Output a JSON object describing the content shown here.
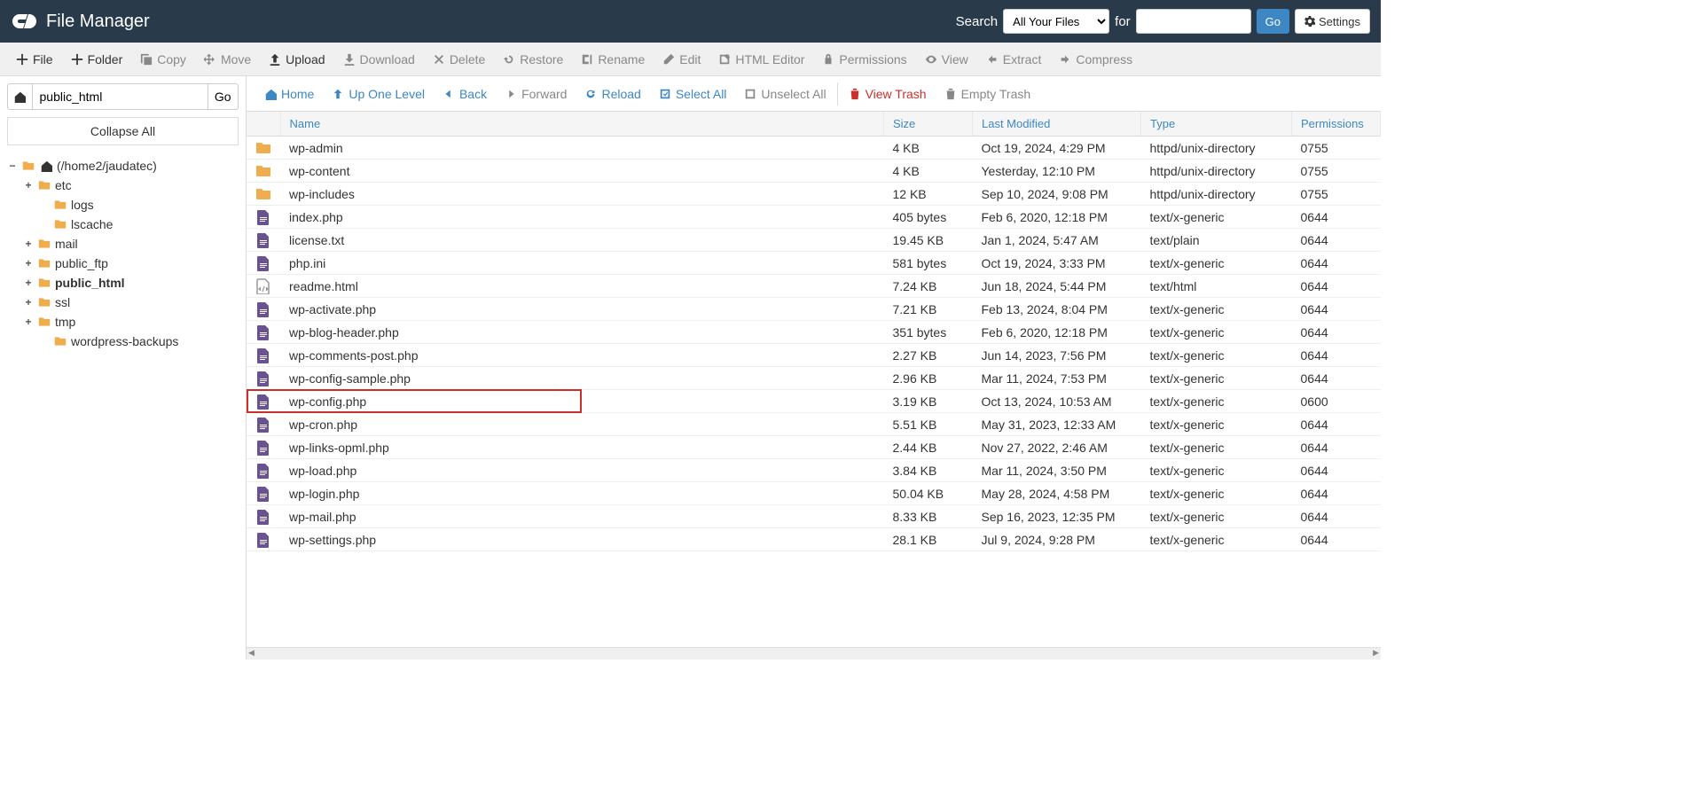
{
  "header": {
    "app_title": "File Manager",
    "search_label": "Search",
    "search_scope": "All Your Files",
    "for_label": "for",
    "go_label": "Go",
    "settings_label": "Settings"
  },
  "toolbar": [
    {
      "label": "File",
      "icon": "plus",
      "active": true
    },
    {
      "label": "Folder",
      "icon": "plus",
      "active": true
    },
    {
      "label": "Copy",
      "icon": "copy",
      "active": false
    },
    {
      "label": "Move",
      "icon": "move",
      "active": false
    },
    {
      "label": "Upload",
      "icon": "upload",
      "active": true
    },
    {
      "label": "Download",
      "icon": "download",
      "active": false
    },
    {
      "label": "Delete",
      "icon": "delete",
      "active": false
    },
    {
      "label": "Restore",
      "icon": "restore",
      "active": false
    },
    {
      "label": "Rename",
      "icon": "rename",
      "active": false
    },
    {
      "label": "Edit",
      "icon": "edit",
      "active": false
    },
    {
      "label": "HTML Editor",
      "icon": "html-editor",
      "active": false
    },
    {
      "label": "Permissions",
      "icon": "permissions",
      "active": false
    },
    {
      "label": "View",
      "icon": "view",
      "active": false
    },
    {
      "label": "Extract",
      "icon": "extract",
      "active": false
    },
    {
      "label": "Compress",
      "icon": "compress",
      "active": false
    }
  ],
  "location": {
    "path_value": "public_html",
    "go_label": "Go",
    "collapse_label": "Collapse All"
  },
  "tree": {
    "root_label": "(/home2/jaudatec)",
    "items": [
      {
        "label": "etc",
        "toggle": "+",
        "depth": 1
      },
      {
        "label": "logs",
        "toggle": "",
        "depth": 2
      },
      {
        "label": "lscache",
        "toggle": "",
        "depth": 2
      },
      {
        "label": "mail",
        "toggle": "+",
        "depth": 1
      },
      {
        "label": "public_ftp",
        "toggle": "+",
        "depth": 1
      },
      {
        "label": "public_html",
        "toggle": "+",
        "depth": 1,
        "bold": true
      },
      {
        "label": "ssl",
        "toggle": "+",
        "depth": 1
      },
      {
        "label": "tmp",
        "toggle": "+",
        "depth": 1
      },
      {
        "label": "wordpress-backups",
        "toggle": "",
        "depth": 2
      }
    ]
  },
  "navbar": [
    {
      "label": "Home",
      "icon": "home",
      "style": "link"
    },
    {
      "label": "Up One Level",
      "icon": "up",
      "style": "link"
    },
    {
      "label": "Back",
      "icon": "back",
      "style": "link"
    },
    {
      "label": "Forward",
      "icon": "forward",
      "style": "disabled"
    },
    {
      "label": "Reload",
      "icon": "reload",
      "style": "link"
    },
    {
      "label": "Select All",
      "icon": "select-all",
      "style": "link"
    },
    {
      "label": "Unselect All",
      "icon": "unselect-all",
      "style": "disabled"
    },
    {
      "label": "View Trash",
      "icon": "trash",
      "style": "danger",
      "sep_before": true
    },
    {
      "label": "Empty Trash",
      "icon": "trash",
      "style": "disabled"
    }
  ],
  "columns": {
    "name": "Name",
    "size": "Size",
    "modified": "Last Modified",
    "type": "Type",
    "permissions": "Permissions"
  },
  "files": [
    {
      "icon": "folder",
      "name": "wp-admin",
      "size": "4 KB",
      "modified": "Oct 19, 2024, 4:29 PM",
      "type": "httpd/unix-directory",
      "perm": "0755"
    },
    {
      "icon": "folder",
      "name": "wp-content",
      "size": "4 KB",
      "modified": "Yesterday, 12:10 PM",
      "type": "httpd/unix-directory",
      "perm": "0755"
    },
    {
      "icon": "folder",
      "name": "wp-includes",
      "size": "12 KB",
      "modified": "Sep 10, 2024, 9:08 PM",
      "type": "httpd/unix-directory",
      "perm": "0755"
    },
    {
      "icon": "file",
      "name": "index.php",
      "size": "405 bytes",
      "modified": "Feb 6, 2020, 12:18 PM",
      "type": "text/x-generic",
      "perm": "0644"
    },
    {
      "icon": "file",
      "name": "license.txt",
      "size": "19.45 KB",
      "modified": "Jan 1, 2024, 5:47 AM",
      "type": "text/plain",
      "perm": "0644"
    },
    {
      "icon": "file",
      "name": "php.ini",
      "size": "581 bytes",
      "modified": "Oct 19, 2024, 3:33 PM",
      "type": "text/x-generic",
      "perm": "0644"
    },
    {
      "icon": "html",
      "name": "readme.html",
      "size": "7.24 KB",
      "modified": "Jun 18, 2024, 5:44 PM",
      "type": "text/html",
      "perm": "0644"
    },
    {
      "icon": "file",
      "name": "wp-activate.php",
      "size": "7.21 KB",
      "modified": "Feb 13, 2024, 8:04 PM",
      "type": "text/x-generic",
      "perm": "0644"
    },
    {
      "icon": "file",
      "name": "wp-blog-header.php",
      "size": "351 bytes",
      "modified": "Feb 6, 2020, 12:18 PM",
      "type": "text/x-generic",
      "perm": "0644"
    },
    {
      "icon": "file",
      "name": "wp-comments-post.php",
      "size": "2.27 KB",
      "modified": "Jun 14, 2023, 7:56 PM",
      "type": "text/x-generic",
      "perm": "0644"
    },
    {
      "icon": "file",
      "name": "wp-config-sample.php",
      "size": "2.96 KB",
      "modified": "Mar 11, 2024, 7:53 PM",
      "type": "text/x-generic",
      "perm": "0644"
    },
    {
      "icon": "file",
      "name": "wp-config.php",
      "size": "3.19 KB",
      "modified": "Oct 13, 2024, 10:53 AM",
      "type": "text/x-generic",
      "perm": "0600",
      "highlight": true
    },
    {
      "icon": "file",
      "name": "wp-cron.php",
      "size": "5.51 KB",
      "modified": "May 31, 2023, 12:33 AM",
      "type": "text/x-generic",
      "perm": "0644"
    },
    {
      "icon": "file",
      "name": "wp-links-opml.php",
      "size": "2.44 KB",
      "modified": "Nov 27, 2022, 2:46 AM",
      "type": "text/x-generic",
      "perm": "0644"
    },
    {
      "icon": "file",
      "name": "wp-load.php",
      "size": "3.84 KB",
      "modified": "Mar 11, 2024, 3:50 PM",
      "type": "text/x-generic",
      "perm": "0644"
    },
    {
      "icon": "file",
      "name": "wp-login.php",
      "size": "50.04 KB",
      "modified": "May 28, 2024, 4:58 PM",
      "type": "text/x-generic",
      "perm": "0644"
    },
    {
      "icon": "file",
      "name": "wp-mail.php",
      "size": "8.33 KB",
      "modified": "Sep 16, 2023, 12:35 PM",
      "type": "text/x-generic",
      "perm": "0644"
    },
    {
      "icon": "file",
      "name": "wp-settings.php",
      "size": "28.1 KB",
      "modified": "Jul 9, 2024, 9:28 PM",
      "type": "text/x-generic",
      "perm": "0644"
    }
  ]
}
